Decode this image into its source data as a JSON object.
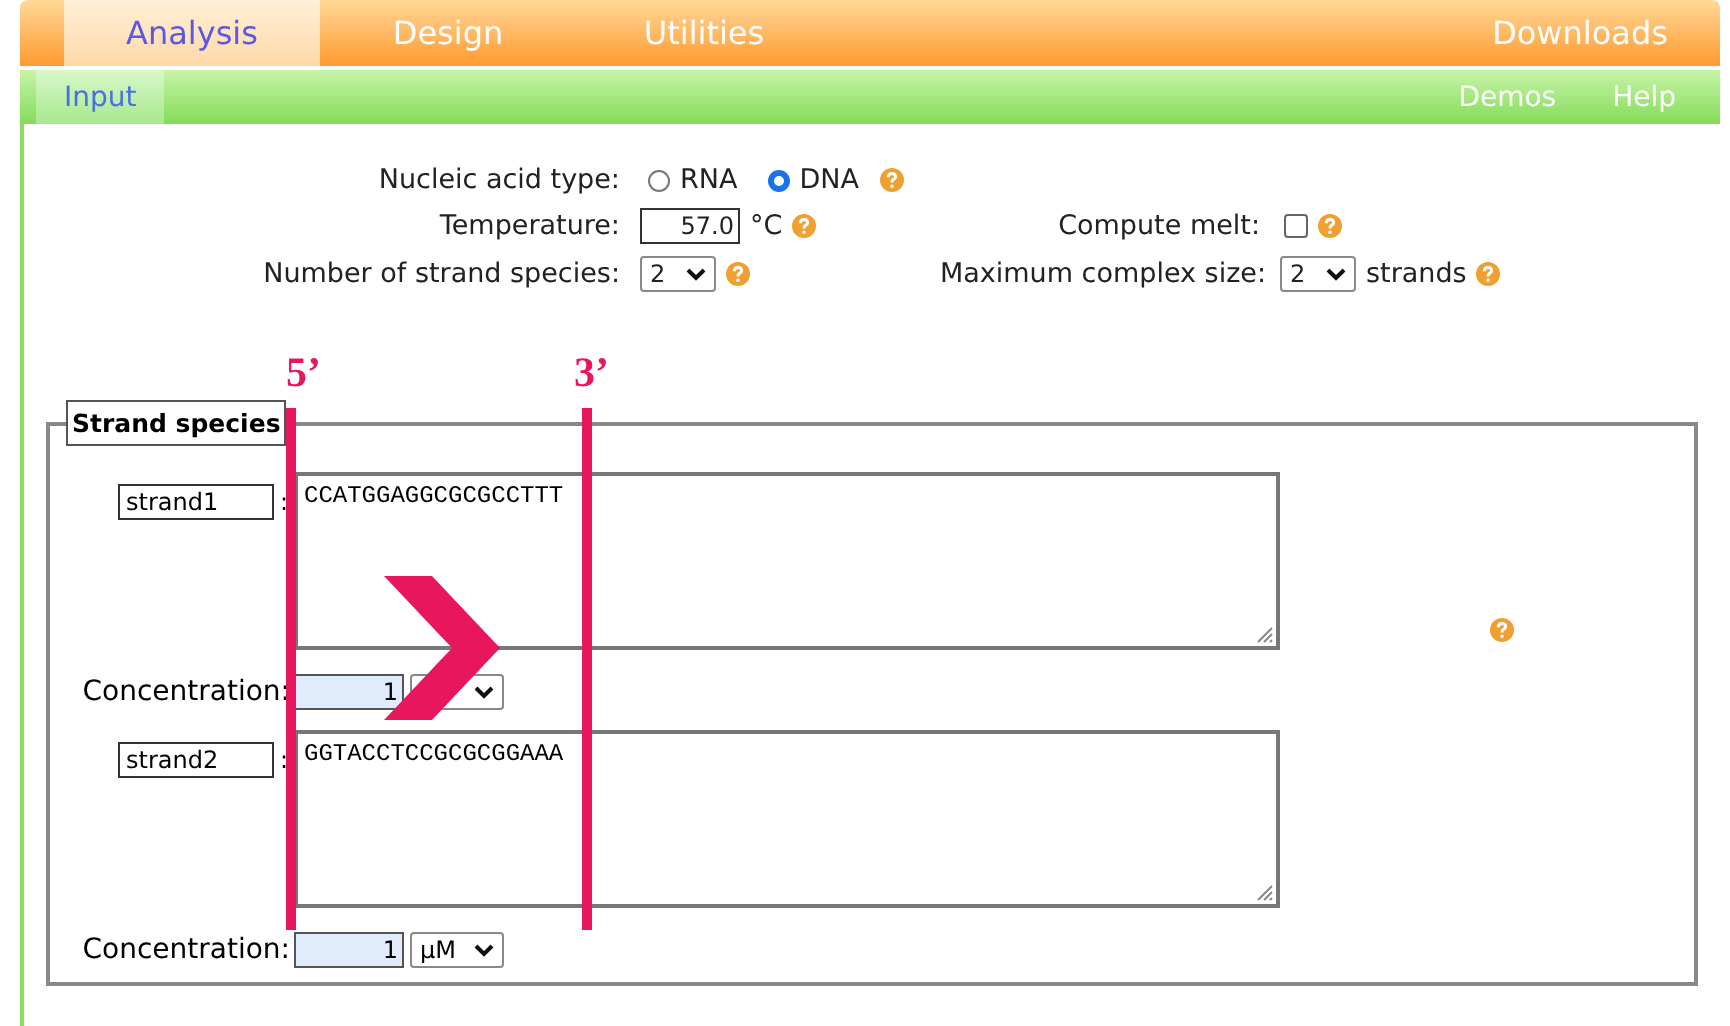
{
  "tabs": [
    {
      "label": "Analysis",
      "selected": true
    },
    {
      "label": "Design",
      "selected": false
    },
    {
      "label": "Utilities",
      "selected": false
    },
    {
      "label": "Downloads",
      "selected": false
    }
  ],
  "subnav": {
    "items": [
      {
        "label": "Input",
        "selected": true
      }
    ],
    "links": [
      "Demos",
      "Help"
    ]
  },
  "form": {
    "nucleic_acid_type": {
      "label": "Nucleic acid type:",
      "options": [
        {
          "label": "RNA",
          "selected": false
        },
        {
          "label": "DNA",
          "selected": true
        }
      ]
    },
    "temperature": {
      "label": "Temperature:",
      "value": "57.0",
      "unit": "°C"
    },
    "compute_melt": {
      "label": "Compute melt:",
      "checked": false
    },
    "strand_species_count": {
      "label": "Number of strand species:",
      "value": "2"
    },
    "max_complex_size": {
      "label": "Maximum complex size:",
      "value": "2",
      "unit": "strands"
    }
  },
  "strand_species": {
    "legend": "Strand species",
    "strands": [
      {
        "name": "strand1",
        "separator": ":",
        "sequence": "CCATGGAGGCGCGCCTTT",
        "concentration_label": "Concentration:",
        "concentration": "1"
      },
      {
        "name": "strand2",
        "separator": ":",
        "sequence": "GGTACCTCCGCGCGGAAA",
        "concentration_label": "Concentration:",
        "concentration": "1",
        "unit": "µM"
      }
    ]
  },
  "annotations": {
    "five_prime": "5’",
    "three_prime": "3’"
  }
}
